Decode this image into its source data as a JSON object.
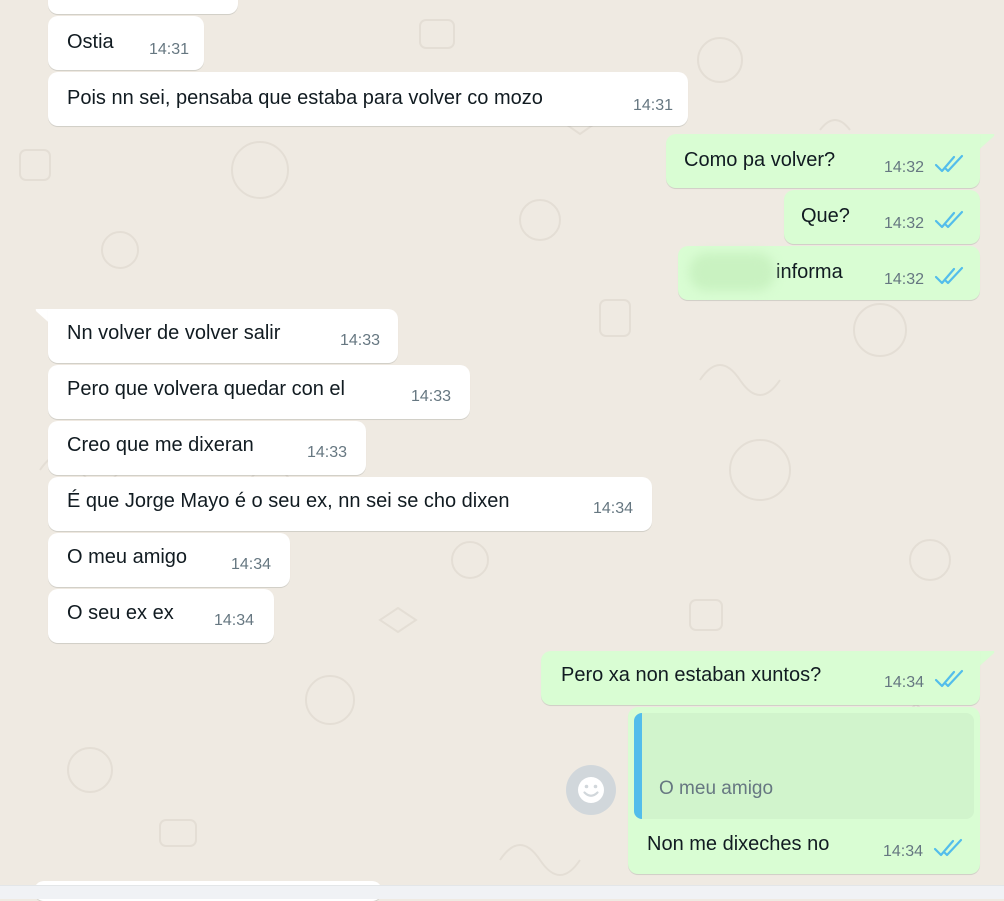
{
  "theme": {
    "chat_background": "#efeae2",
    "incoming_bubble": "#ffffff",
    "outgoing_bubble": "#d9fdd3",
    "read_tick_color": "#53bdeb",
    "timestamp_color": "#667781",
    "quote_accent": "#53bdeb"
  },
  "messages": [
    {
      "direction": "in",
      "text": "Ostia",
      "time": "14:31"
    },
    {
      "direction": "in",
      "text": "Pois nn sei, pensaba que estaba para volver co mozo",
      "time": "14:31"
    },
    {
      "direction": "out",
      "text": "Como pa volver?",
      "time": "14:32",
      "status": "read"
    },
    {
      "direction": "out",
      "text": "Que?",
      "time": "14:32",
      "status": "read"
    },
    {
      "direction": "out",
      "text": "informa",
      "time": "14:32",
      "status": "read"
    },
    {
      "direction": "in",
      "text": "Nn volver de volver salir",
      "time": "14:33"
    },
    {
      "direction": "in",
      "text": "Pero que volvera quedar con el",
      "time": "14:33"
    },
    {
      "direction": "in",
      "text": "Creo que me dixeran",
      "time": "14:33"
    },
    {
      "direction": "in",
      "text": "É que Jorge Mayo é o seu ex, nn sei se cho dixen",
      "time": "14:34"
    },
    {
      "direction": "in",
      "text": "O meu amigo",
      "time": "14:34"
    },
    {
      "direction": "in",
      "text": "O seu ex ex",
      "time": "14:34"
    },
    {
      "direction": "out",
      "text": "Pero xa non estaban xuntos?",
      "time": "14:34",
      "status": "read"
    },
    {
      "direction": "out",
      "quoted": "O meu amigo",
      "text": "Non me dixeches no",
      "time": "14:34",
      "status": "read"
    }
  ],
  "icons": {
    "read_receipt": "double-check-icon",
    "reaction_button": "smiley-icon"
  }
}
